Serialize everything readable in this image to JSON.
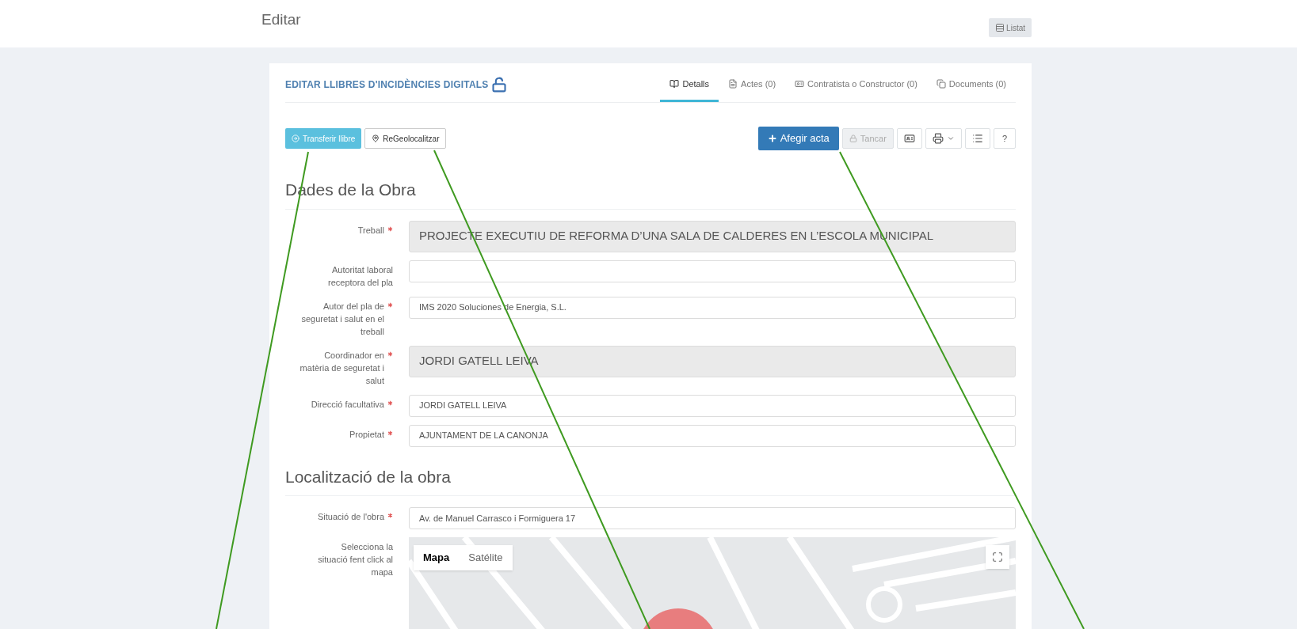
{
  "header": {
    "title": "Editar",
    "listat_button": "Listat"
  },
  "card": {
    "title": "EDITAR LLIBRES D'INCIDÈNCIES DIGITALS",
    "tabs": [
      {
        "label": "Detalls",
        "kind": "book",
        "selected": true
      },
      {
        "label": "Actes (0)",
        "kind": "file",
        "selected": false
      },
      {
        "label": "Contratista o Constructor (0)",
        "kind": "card",
        "selected": false
      },
      {
        "label": "Documents (0)",
        "kind": "copy",
        "selected": false
      }
    ],
    "left_buttons": [
      {
        "label": "Transferir llibre",
        "kind": "transfer"
      },
      {
        "label": "ReGeolocalitzar",
        "kind": "pin"
      }
    ],
    "right_buttons": [
      {
        "label": "Afegir acta",
        "kind": "add",
        "disabled": false
      },
      {
        "label": "Tancar",
        "kind": "lock",
        "disabled": true
      },
      {
        "kind": "idcard",
        "disabled": false
      },
      {
        "kind": "print",
        "disabled": false
      },
      {
        "kind": "list",
        "disabled": false
      },
      {
        "label": "?",
        "kind": "help",
        "disabled": false
      }
    ],
    "sections": [
      {
        "heading": "Dades de la Obra",
        "fields": [
          {
            "label": "Treball",
            "required": true,
            "disabled": true,
            "value": "PROJECTE EXECUTIU DE REFORMA D’UNA SALA DE CALDERES EN L’ESCOLA MUNICIPAL"
          },
          {
            "label": "Autoritat laboral receptora del pla",
            "required": false,
            "disabled": false
          },
          {
            "label": "Autor del pla de seguretat i salut en el treball",
            "required": true,
            "disabled": false,
            "value": "IMS 2020 Soluciones de Energia, S.L."
          },
          {
            "label": "Coordinador en matèria de seguretat i salut",
            "required": true,
            "disabled": true,
            "value": "JORDI GATELL LEIVA"
          },
          {
            "label": "Direcció facultativa",
            "required": true,
            "disabled": false,
            "value": "JORDI GATELL LEIVA"
          },
          {
            "label": "Propietat",
            "required": true,
            "disabled": false,
            "value": "AJUNTAMENT DE LA CANONJA"
          }
        ]
      },
      {
        "heading": "Localització de la obra",
        "fields": [
          {
            "label": "Situació de l'obra",
            "required": true,
            "disabled": false,
            "value": "Av. de Manuel Carrasco i Formiguera 17"
          }
        ]
      }
    ],
    "map": {
      "label": "Selecciona la situació fent click al mapa",
      "types": [
        {
          "label": "Mapa",
          "selected": true
        },
        {
          "label": "Satélite",
          "selected": false
        }
      ]
    }
  }
}
